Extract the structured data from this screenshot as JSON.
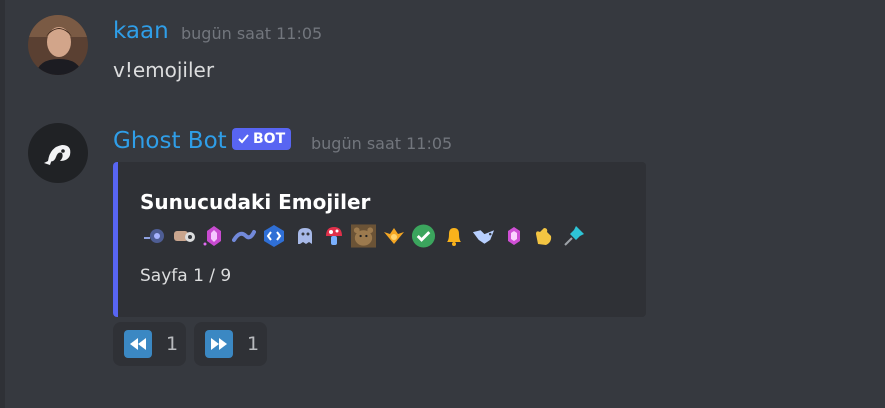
{
  "messages": [
    {
      "author": "kaan",
      "timestamp": "bugün saat 11:05",
      "content": "v!emojiler"
    },
    {
      "author": "Ghost Bot",
      "badge": "BOT",
      "timestamp": "bugün saat 11:05",
      "embed": {
        "title": "Sunucudaki Emojiler",
        "footer": "Sayfa 1 / 9",
        "accent_color": "#5865f2",
        "emoji_icons": [
          "wheel-emoji-icon",
          "fist-emoji-icon",
          "crystal-emoji-icon",
          "wave-emoji-icon",
          "code-emoji-icon",
          "ghost-emoji-icon",
          "mushroom-emoji-icon",
          "bear-emoji-icon",
          "wings-emoji-icon",
          "checkmark-emoji-icon",
          "bell-emoji-icon",
          "dragon-emoji-icon",
          "gem-emoji-icon",
          "clap-emoji-icon",
          "pushpin-emoji-icon"
        ]
      },
      "reactions": [
        {
          "icon": "rewind-icon",
          "count": "1"
        },
        {
          "icon": "fast-forward-icon",
          "count": "1"
        }
      ]
    }
  ],
  "colors": {
    "background": "#36393f",
    "username": "#2f9ee8",
    "timestamp": "#72767d",
    "bot_badge": "#5865f2",
    "embed_bg": "#2f3136"
  }
}
